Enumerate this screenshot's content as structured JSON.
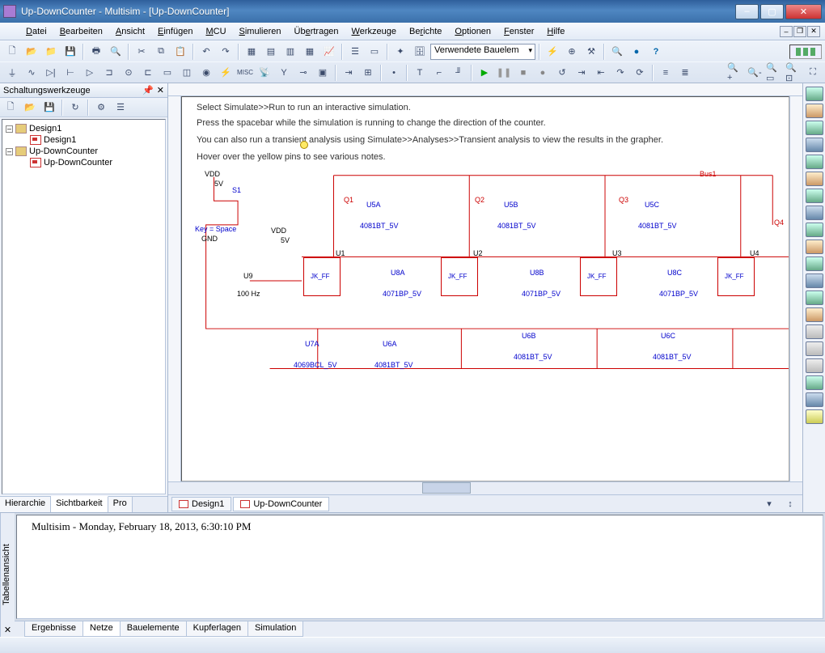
{
  "window": {
    "title": "Up-DownCounter - Multisim - [Up-DownCounter]"
  },
  "menu": {
    "items": [
      "Datei",
      "Bearbeiten",
      "Ansicht",
      "Einfügen",
      "MCU",
      "Simulieren",
      "Übertragen",
      "Werkzeuge",
      "Berichte",
      "Optionen",
      "Fenster",
      "Hilfe"
    ]
  },
  "toolbar": {
    "component_combo": "Verwendete Bauelem"
  },
  "sidebar": {
    "title": "Schaltungswerkzeuge",
    "tree": {
      "design1": "Design1",
      "design1_doc": "Design1",
      "updown": "Up-DownCounter",
      "updown_doc": "Up-DownCounter"
    },
    "tabs": [
      "Hierarchie",
      "Sichtbarkeit",
      "Pro"
    ]
  },
  "canvas": {
    "help1": "Select Simulate>>Run to run an interactive simulation.",
    "help2": "Press the spacebar while the simulation is running to change the direction of the counter.",
    "help3": "You can also run a transient analysis using Simulate>>Analyses>>Transient analysis to view the results in the grapher.",
    "help4": "Hover over the yellow pins     to see various notes.",
    "labels": {
      "vdd1": "VDD",
      "v5_1": "5V",
      "s1": "S1",
      "key": "Key = Space",
      "gnd": "GND",
      "vdd2": "VDD",
      "v5_2": "5V",
      "u9": "U9",
      "hz": "100 Hz",
      "u1": "U1",
      "u2": "U2",
      "u3": "U3",
      "u4": "U4",
      "u5a": "U5A",
      "u5b": "U5B",
      "u5c": "U5C",
      "u6a": "U6A",
      "u6b": "U6B",
      "u6c": "U6C",
      "u7a": "U7A",
      "u8a": "U8A",
      "u8b": "U8B",
      "u8c": "U8C",
      "g4081": "4081BT_5V",
      "g4071": "4071BP_5V",
      "g4069": "4069BCL_5V",
      "jkff": "JK_FF",
      "q1": "Q1",
      "q2": "Q2",
      "q3": "Q3",
      "q4": "Q4",
      "bus": "Bus1"
    }
  },
  "doctabs": {
    "t1": "Design1",
    "t2": "Up-DownCounter"
  },
  "bottom": {
    "label": "Tabellenansicht",
    "msg": "Multisim  -  Monday, February 18, 2013, 6:30:10 PM",
    "tabs": [
      "Ergebnisse",
      "Netze",
      "Bauelemente",
      "Kupferlagen",
      "Simulation"
    ]
  }
}
